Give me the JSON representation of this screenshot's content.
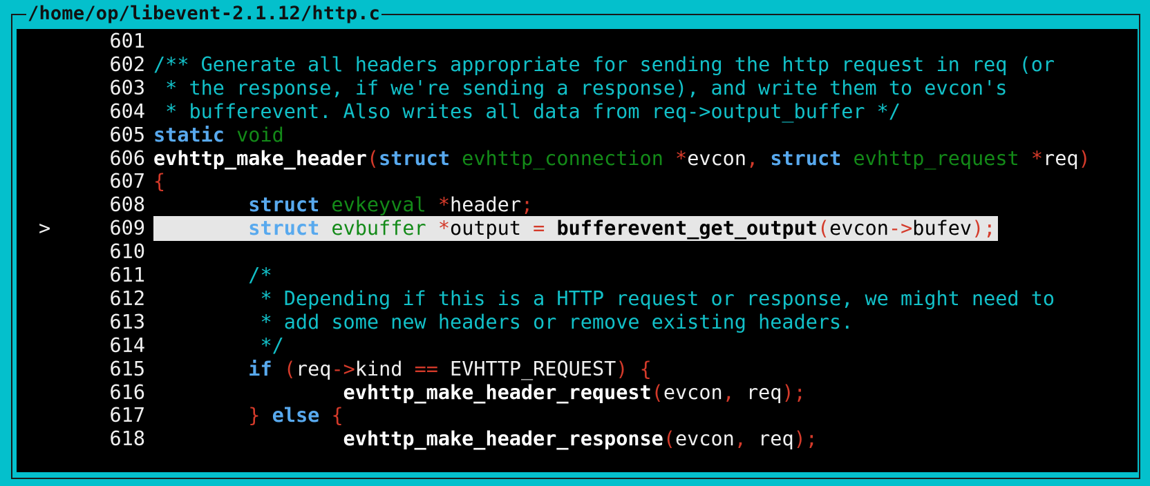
{
  "window": {
    "title": "/home/op/libevent-2.1.12/http.c"
  },
  "source": {
    "current_line_marker": ">",
    "current_line": 609,
    "lines": [
      {
        "n": "601",
        "t": []
      },
      {
        "n": "602",
        "t": [
          [
            "cm",
            "/** Generate all headers appropriate for sending the http request in req (or"
          ]
        ]
      },
      {
        "n": "603",
        "t": [
          [
            "cm",
            " * the response, if we're sending a response), and write them to evcon's"
          ]
        ]
      },
      {
        "n": "604",
        "t": [
          [
            "cm",
            " * bufferevent. Also writes all data from req->output_buffer */"
          ]
        ]
      },
      {
        "n": "605",
        "t": [
          [
            "kw",
            "static"
          ],
          [
            "id",
            " "
          ],
          [
            "ty",
            "void"
          ]
        ]
      },
      {
        "n": "606",
        "t": [
          [
            "fn",
            "evhttp_make_header"
          ],
          [
            "op",
            "("
          ],
          [
            "kw",
            "struct"
          ],
          [
            "id",
            " "
          ],
          [
            "ty",
            "evhttp_connection"
          ],
          [
            "id",
            " "
          ],
          [
            "op",
            "*"
          ],
          [
            "id",
            "evcon"
          ],
          [
            "op",
            ","
          ],
          [
            "id",
            " "
          ],
          [
            "kw",
            "struct"
          ],
          [
            "id",
            " "
          ],
          [
            "ty",
            "evhttp_request"
          ],
          [
            "id",
            " "
          ],
          [
            "op",
            "*"
          ],
          [
            "id",
            "req"
          ],
          [
            "op",
            ")"
          ]
        ]
      },
      {
        "n": "607",
        "t": [
          [
            "op",
            "{"
          ]
        ]
      },
      {
        "n": "608",
        "t": [
          [
            "id",
            "        "
          ],
          [
            "kw",
            "struct"
          ],
          [
            "id",
            " "
          ],
          [
            "ty",
            "evkeyval"
          ],
          [
            "id",
            " "
          ],
          [
            "op",
            "*"
          ],
          [
            "id",
            "header"
          ],
          [
            "op",
            ";"
          ]
        ]
      },
      {
        "n": "609",
        "t": [
          [
            "id",
            "        "
          ],
          [
            "kw",
            "struct"
          ],
          [
            "id",
            " "
          ],
          [
            "ty",
            "evbuffer"
          ],
          [
            "id",
            " "
          ],
          [
            "op",
            "*"
          ],
          [
            "id",
            "output "
          ],
          [
            "op",
            "="
          ],
          [
            "id",
            " "
          ],
          [
            "fn",
            "bufferevent_get_output"
          ],
          [
            "op",
            "("
          ],
          [
            "id",
            "evcon"
          ],
          [
            "op",
            "->"
          ],
          [
            "id",
            "bufev"
          ],
          [
            "op",
            ");"
          ]
        ]
      },
      {
        "n": "610",
        "t": []
      },
      {
        "n": "611",
        "t": [
          [
            "id",
            "        "
          ],
          [
            "cm",
            "/*"
          ]
        ]
      },
      {
        "n": "612",
        "t": [
          [
            "id",
            "        "
          ],
          [
            "cm",
            " * Depending if this is a HTTP request or response, we might need to"
          ]
        ]
      },
      {
        "n": "613",
        "t": [
          [
            "id",
            "        "
          ],
          [
            "cm",
            " * add some new headers or remove existing headers."
          ]
        ]
      },
      {
        "n": "614",
        "t": [
          [
            "id",
            "        "
          ],
          [
            "cm",
            " */"
          ]
        ]
      },
      {
        "n": "615",
        "t": [
          [
            "id",
            "        "
          ],
          [
            "kw",
            "if"
          ],
          [
            "id",
            " "
          ],
          [
            "op",
            "("
          ],
          [
            "id",
            "req"
          ],
          [
            "op",
            "->"
          ],
          [
            "id",
            "kind "
          ],
          [
            "op",
            "=="
          ],
          [
            "id",
            " EVHTTP_REQUEST"
          ],
          [
            "op",
            ")"
          ],
          [
            "id",
            " "
          ],
          [
            "op",
            "{"
          ]
        ]
      },
      {
        "n": "616",
        "t": [
          [
            "id",
            "                "
          ],
          [
            "fn",
            "evhttp_make_header_request"
          ],
          [
            "op",
            "("
          ],
          [
            "id",
            "evcon"
          ],
          [
            "op",
            ","
          ],
          [
            "id",
            " req"
          ],
          [
            "op",
            ");"
          ]
        ]
      },
      {
        "n": "617",
        "t": [
          [
            "id",
            "        "
          ],
          [
            "op",
            "}"
          ],
          [
            "id",
            " "
          ],
          [
            "kw",
            "else"
          ],
          [
            "id",
            " "
          ],
          [
            "op",
            "{"
          ]
        ]
      },
      {
        "n": "618",
        "t": [
          [
            "id",
            "                "
          ],
          [
            "fn",
            "evhttp_make_header_response"
          ],
          [
            "op",
            "("
          ],
          [
            "id",
            "evcon"
          ],
          [
            "op",
            ","
          ],
          [
            "id",
            " req"
          ],
          [
            "op",
            ");"
          ]
        ]
      }
    ]
  }
}
